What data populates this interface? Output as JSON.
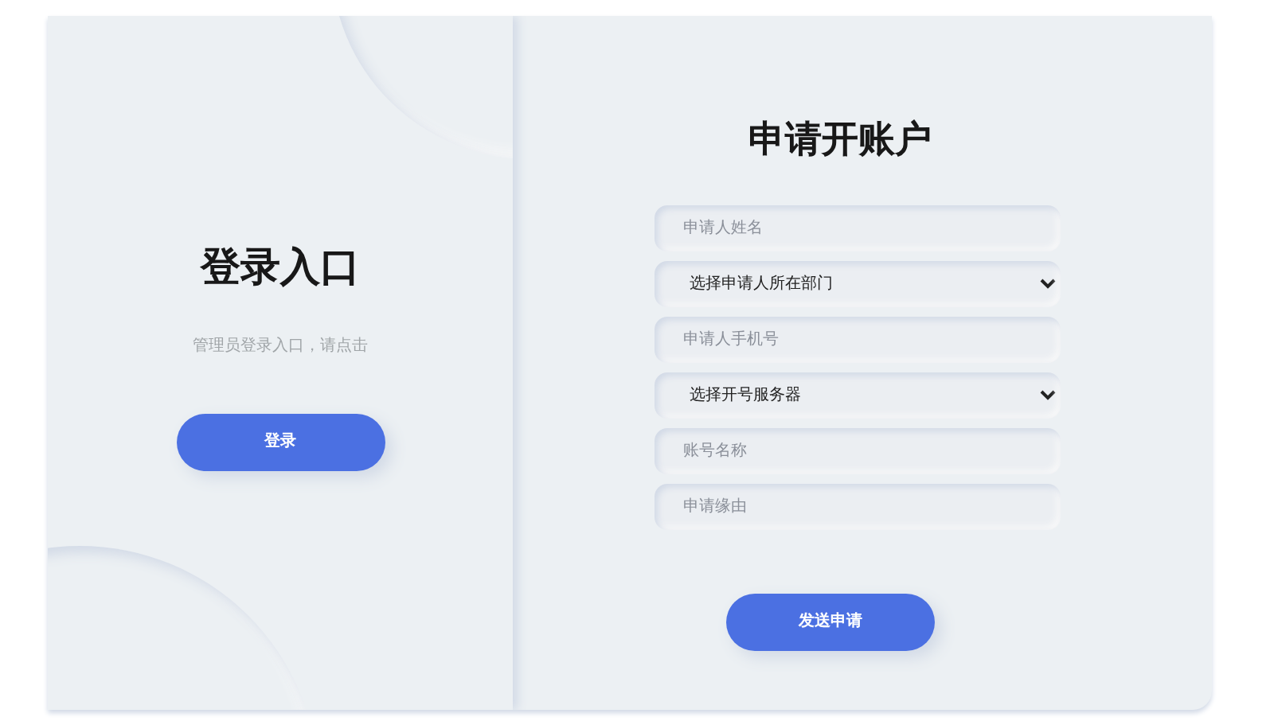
{
  "login_panel": {
    "title": "登录入口",
    "description": "管理员登录入口，请点击",
    "button": "登录"
  },
  "apply_panel": {
    "title": "申请开账户",
    "fields": [
      {
        "kind": "input",
        "placeholder": "申请人姓名"
      },
      {
        "kind": "select",
        "value": "选择申请人所在部门"
      },
      {
        "kind": "input",
        "placeholder": "申请人手机号"
      },
      {
        "kind": "select",
        "value": "选择开号服务器"
      },
      {
        "kind": "input",
        "placeholder": "账号名称"
      },
      {
        "kind": "input",
        "placeholder": "申请缘由"
      }
    ],
    "button": "发送申请"
  }
}
